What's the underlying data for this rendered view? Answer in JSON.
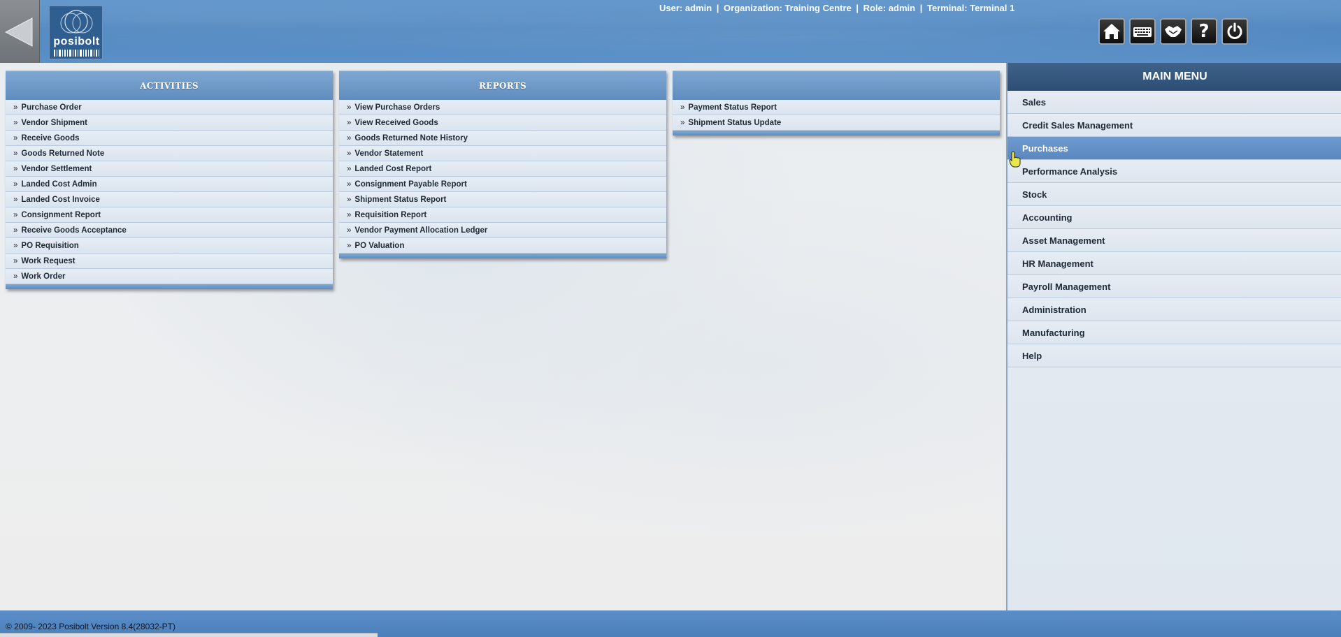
{
  "header": {
    "logo_text": "posibolt",
    "user_info": {
      "user": "User: admin",
      "organization": "Organization: Training Centre",
      "role": "Role: admin",
      "terminal": "Terminal: Terminal 1",
      "separator": "|"
    },
    "tool_buttons": [
      {
        "icon": "home-icon"
      },
      {
        "icon": "keyboard-icon"
      },
      {
        "icon": "handshake-icon"
      },
      {
        "icon": "help-icon",
        "glyph": "?"
      },
      {
        "icon": "power-icon"
      }
    ]
  },
  "panels": {
    "activities": {
      "title": "ACTIVITIES",
      "items": [
        "Purchase Order",
        "Vendor Shipment",
        "Receive Goods",
        "Goods Returned Note",
        "Vendor Settlement",
        "Landed Cost Admin",
        "Landed Cost Invoice",
        "Consignment Report",
        "Receive Goods Acceptance",
        "PO Requisition",
        "Work Request",
        "Work Order"
      ]
    },
    "reports": {
      "title": "REPORTS",
      "items": [
        "View Purchase Orders",
        "View Received Goods",
        "Goods Returned Note History",
        "Vendor Statement",
        "Landed Cost Report",
        "Consignment Payable Report",
        "Shipment Status Report",
        "Requisition Report",
        "Vendor Payment Allocation Ledger",
        "PO Valuation"
      ]
    },
    "other": {
      "title": "",
      "items": [
        "Payment Status Report",
        "Shipment Status Update"
      ]
    },
    "arrow": "»"
  },
  "main_menu": {
    "title": "MAIN MENU",
    "active": "Purchases",
    "items": [
      "Sales",
      "Credit Sales Management",
      "Purchases",
      "Performance Analysis",
      "Stock",
      "Accounting",
      "Asset Management",
      "HR Management",
      "Payroll Management",
      "Administration",
      "Manufacturing",
      "Help"
    ]
  },
  "footer": {
    "copyright": "© 2009- 2023 Posibolt Version  8.4(28032-PT)"
  },
  "colors": {
    "header_blue": "#4d85bf",
    "menu_head": "#2d4e74",
    "active_item": "#5b88c0"
  }
}
